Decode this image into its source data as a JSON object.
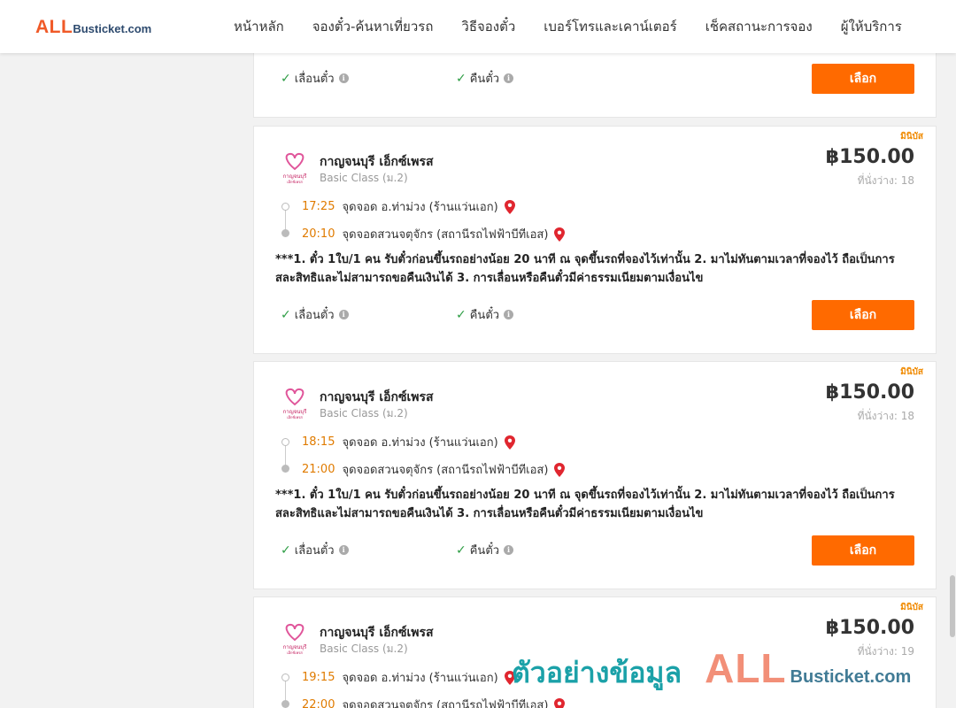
{
  "header": {
    "logo_all": "ALL",
    "logo_rest": "Busticket.com",
    "nav": [
      "หน้าหลัก",
      "จองตั๋ว-ค้นหาเที่ยวรถ",
      "วิธีจองตั๋ว",
      "เบอร์โทรและเคาน์เตอร์",
      "เช็คสถานะการจอง",
      "ผู้ให้บริการ"
    ]
  },
  "top_card": {
    "opt_change": "เลื่อนตั๋ว",
    "opt_refund": "คืนตั๋ว",
    "select_label": "เลือก"
  },
  "cards": [
    {
      "tag": "มินิบัส",
      "operator": "กาญจนบุรี เอ็กซ์เพรส",
      "bus_class": "Basic Class (ม.2)",
      "price": "฿150.00",
      "seats": "ที่นั่งว่าง: 18",
      "depart_time": "17:25",
      "depart_stop": "จุดจอด อ.ท่าม่วง (ร้านแว่นเอก)",
      "arrive_time": "20:10",
      "arrive_stop": "จุดจอดสวนจตุจักร (สถานีรถไฟฟ้าบีทีเอส)",
      "note": "***1. ตั๋ว 1ใบ/1 คน รับตั๋วก่อนขึ้นรถอย่างน้อย 20 นาที ณ จุดขึ้นรถที่จองไว้เท่านั้น 2. มาไม่ทันตามเวลาที่จองไว้ ถือเป็นการสละสิทธิและไม่สามารถขอคืนเงินได้ 3. การเลื่อนหรือคืนตั๋วมีค่าธรรมเนียมตามเงื่อนไข",
      "opt_change": "เลื่อนตั๋ว",
      "opt_refund": "คืนตั๋ว",
      "select_label": "เลือก"
    },
    {
      "tag": "มินิบัส",
      "operator": "กาญจนบุรี เอ็กซ์เพรส",
      "bus_class": "Basic Class (ม.2)",
      "price": "฿150.00",
      "seats": "ที่นั่งว่าง: 18",
      "depart_time": "18:15",
      "depart_stop": "จุดจอด อ.ท่าม่วง (ร้านแว่นเอก)",
      "arrive_time": "21:00",
      "arrive_stop": "จุดจอดสวนจตุจักร (สถานีรถไฟฟ้าบีทีเอส)",
      "note": "***1. ตั๋ว 1ใบ/1 คน รับตั๋วก่อนขึ้นรถอย่างน้อย 20 นาที ณ จุดขึ้นรถที่จองไว้เท่านั้น 2. มาไม่ทันตามเวลาที่จองไว้ ถือเป็นการสละสิทธิและไม่สามารถขอคืนเงินได้ 3. การเลื่อนหรือคืนตั๋วมีค่าธรรมเนียมตามเงื่อนไข",
      "opt_change": "เลื่อนตั๋ว",
      "opt_refund": "คืนตั๋ว",
      "select_label": "เลือก"
    },
    {
      "tag": "มินิบัส",
      "operator": "กาญจนบุรี เอ็กซ์เพรส",
      "bus_class": "Basic Class (ม.2)",
      "price": "฿150.00",
      "seats": "ที่นั่งว่าง: 19",
      "depart_time": "19:15",
      "depart_stop": "จุดจอด อ.ท่าม่วง (ร้านแว่นเอก)",
      "arrive_time": "22:00",
      "arrive_stop": "จุดจอดสวนจตุจักร (สถานีรถไฟฟ้าบีทีเอส)"
    }
  ],
  "watermark": {
    "text": "ตัวอย่างข้อมูล",
    "all": "ALL",
    "rest": "Busticket.com"
  },
  "colors": {
    "accent": "#ff6a00",
    "time": "#e07b00",
    "check": "#2e9d45",
    "pin": "#e0262f"
  }
}
